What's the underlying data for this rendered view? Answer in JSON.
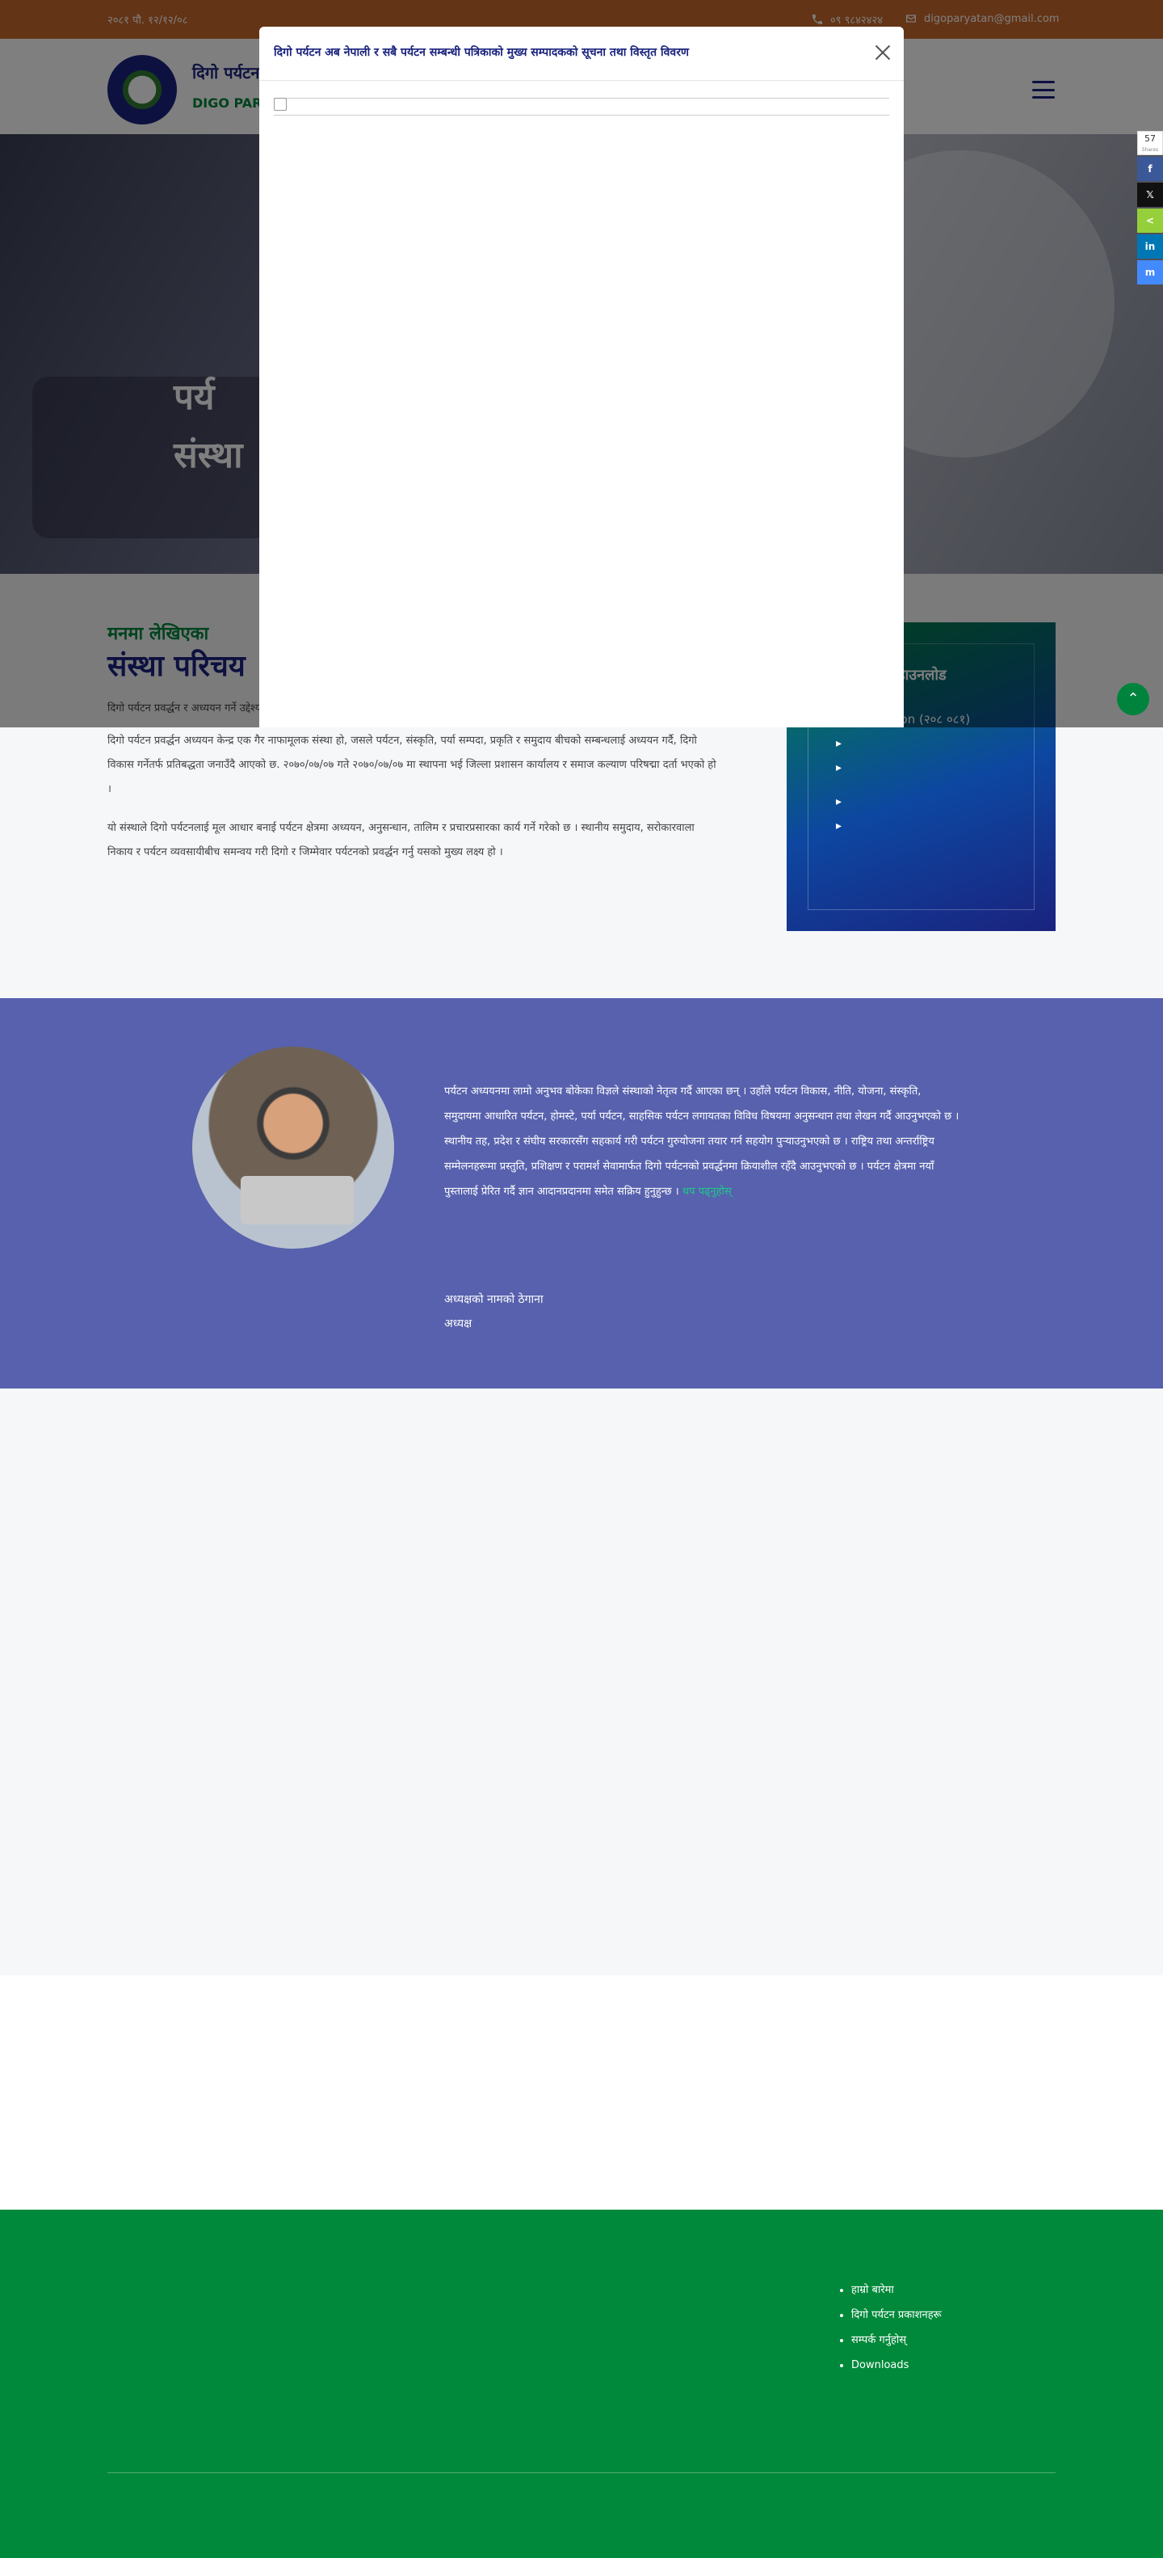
{
  "topbar": {
    "date": "२०८१ पौ. १२/१२/०८",
    "phone": "०९ ९८४२४२४",
    "email": "digoparyatan@gmail.com"
  },
  "header": {
    "brand_np": "दिगो पर्यटन",
    "brand_en": "DIGO PARY"
  },
  "hero": {
    "line1": "पर्य",
    "line2": "संस्था"
  },
  "content": {
    "subheading": "मनमा लेखिएका",
    "title": "संस्था परिचय",
    "paragraph0": "दिगो पर्यटन प्रवर्द्धन र अध्ययन गर्ने उद्देश्यले स्थापित यो संस्था",
    "paragraph1": "दिगो पर्यटन प्रवर्द्धन अध्ययन केन्द्र एक गैर नाफामूलक संस्था हो, जसले पर्यटन, संस्कृति, पर्या सम्पदा, प्रकृति र समुदाय बीचको सम्बन्धलाई अध्ययन गर्दै, दिगो विकास गर्नेतर्फ प्रतिबद्धता जनाउँदै आएको छ. २०७०/०७/०७ गते २०७०/०७/०७ मा स्थापना भई जिल्ला प्रशासन कार्यालय र समाज कल्याण परिषद्मा दर्ता भएको हो ।",
    "paragraph2": "यो संस्थाले दिगो पर्यटनलाई मूल आधार बनाई पर्यटन क्षेत्रमा अध्ययन, अनुसन्धान, तालिम र प्रचारप्रसारका कार्य गर्ने गरेको छ । स्थानीय समुदाय, सरोकारवाला निकाय र पर्यटन व्यवसायीबीच समन्वय गरी दिगो र जिम्मेवार पर्यटनको प्रवर्द्धन गर्नु यसको मुख्य लक्ष्य हो ।"
  },
  "sidebar": {
    "title": "डाउनलोड",
    "items": [
      "Collection (२०८ ०८१)",
      "",
      "",
      "",
      ""
    ]
  },
  "author": {
    "bio": "पर्यटन अध्ययनमा लामो अनुभव बोकेका विज्ञले संस्थाको नेतृत्व गर्दै आएका छन् । उहाँले पर्यटन विकास, नीति, योजना, संस्कृति, समुदायमा आधारित पर्यटन, होमस्टे, पर्या पर्यटन, साहसिक पर्यटन लगायतका विविध विषयमा अनुसन्धान तथा लेखन गर्दै आउनुभएको छ । स्थानीय तह, प्रदेश र संघीय सरकारसँग सहकार्य गरी पर्यटन गुरुयोजना तयार गर्न सहयोग पुर्‍याउनुभएको छ । राष्ट्रिय तथा अन्तर्राष्ट्रिय सम्मेलनहरूमा प्रस्तुति, प्रशिक्षण र परामर्श सेवामार्फत दिगो पर्यटनको प्रवर्द्धनमा क्रियाशील रहँदै आउनुभएको छ । पर्यटन क्षेत्रमा नयाँ पुस्तालाई प्रेरित गर्दै ज्ञान आदानप्रदानमा समेत सक्रिय हुनुहुन्छ ।",
    "more": "थप पढ्नुहोस्",
    "name": "अध्यक्षको नामको ठेगाना",
    "role": "अध्यक्ष"
  },
  "footer": {
    "links": [
      "हाम्रो बारेमा",
      "दिगो पर्यटन प्रकाशनहरू",
      "सम्पर्क गर्नुहोस्",
      "Downloads"
    ]
  },
  "share": {
    "count": "57",
    "count_label": "Shares",
    "buttons": [
      {
        "label": "f",
        "icon": "facebook-icon",
        "color": "#3b5998"
      },
      {
        "label": "𝕏",
        "icon": "x-icon",
        "color": "#111111"
      },
      {
        "label": "<",
        "icon": "share-icon",
        "color": "#95d03a"
      },
      {
        "label": "in",
        "icon": "linkedin-icon",
        "color": "#0077b5"
      },
      {
        "label": "m",
        "icon": "messenger-icon",
        "color": "#448aff"
      }
    ]
  },
  "modal": {
    "title": "दिगो पर्यटन अब नेपाली र सबै पर्यटन सम्बन्धी पत्रिकाको मुख्य सम्पादकको सूचना तथा विस्तृत विवरण"
  },
  "colors": {
    "topbar": "#c8692d",
    "brand_blue": "#1a237e",
    "brand_green": "#00843d",
    "author_band": "#5761ad",
    "footer": "#00893a"
  }
}
